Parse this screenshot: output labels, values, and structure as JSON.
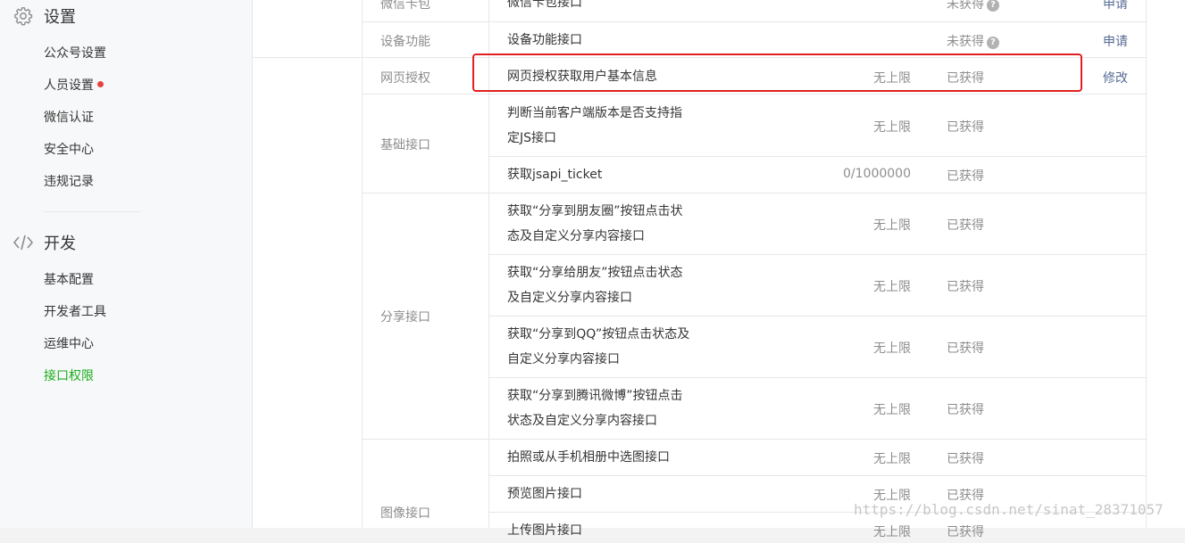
{
  "sidebar": {
    "settings": {
      "icon": "gear-icon",
      "title": "设置",
      "items": [
        {
          "label": "公众号设置"
        },
        {
          "label": "人员设置",
          "badge": true
        },
        {
          "label": "微信认证"
        },
        {
          "label": "安全中心"
        },
        {
          "label": "违规记录"
        }
      ]
    },
    "develop": {
      "icon": "code-icon",
      "title": "开发",
      "items": [
        {
          "label": "基本配置"
        },
        {
          "label": "开发者工具"
        },
        {
          "label": "运维中心"
        },
        {
          "label": "接口权限",
          "active": true
        }
      ]
    }
  },
  "colors": {
    "accent": "#1aad19",
    "link": "#576b95",
    "highlight_border": "#e02020",
    "badge": "#e64340"
  },
  "table": {
    "rows": [
      {
        "category": "微信卡包",
        "name": "微信卡包接口",
        "limit": "",
        "status": "未获得",
        "status_help": true,
        "action": "申请"
      },
      {
        "category": "设备功能",
        "name": "设备功能接口",
        "limit": "",
        "status": "未获得",
        "status_help": true,
        "action": "申请"
      },
      {
        "category": "网页授权",
        "name": "网页授权获取用户基本信息",
        "limit": "无上限",
        "status": "已获得",
        "action": "修改",
        "highlighted": true
      },
      {
        "category": "基础接口",
        "name": "判断当前客户端版本是否支持指定JS接口",
        "limit": "无上限",
        "status": "已获得"
      },
      {
        "category": "",
        "name": "获取jsapi_ticket",
        "limit": "0/1000000",
        "status": "已获得"
      },
      {
        "category": "分享接口",
        "name": "获取“分享到朋友圈”按钮点击状态及自定义分享内容接口",
        "limit": "无上限",
        "status": "已获得"
      },
      {
        "category": "",
        "name": "获取“分享给朋友”按钮点击状态及自定义分享内容接口",
        "limit": "无上限",
        "status": "已获得"
      },
      {
        "category": "",
        "name": "获取“分享到QQ”按钮点击状态及自定义分享内容接口",
        "limit": "无上限",
        "status": "已获得"
      },
      {
        "category": "",
        "name": "获取“分享到腾讯微博”按钮点击状态及自定义分享内容接口",
        "limit": "无上限",
        "status": "已获得"
      },
      {
        "category": "图像接口",
        "name": "拍照或从手机相册中选图接口",
        "limit": "无上限",
        "status": "已获得"
      },
      {
        "category": "",
        "name": "预览图片接口",
        "limit": "无上限",
        "status": "已获得"
      },
      {
        "category": "",
        "name": "上传图片接口",
        "limit": "无上限",
        "status": "已获得"
      }
    ]
  },
  "watermark": "https://blog.csdn.net/sinat_28371057"
}
